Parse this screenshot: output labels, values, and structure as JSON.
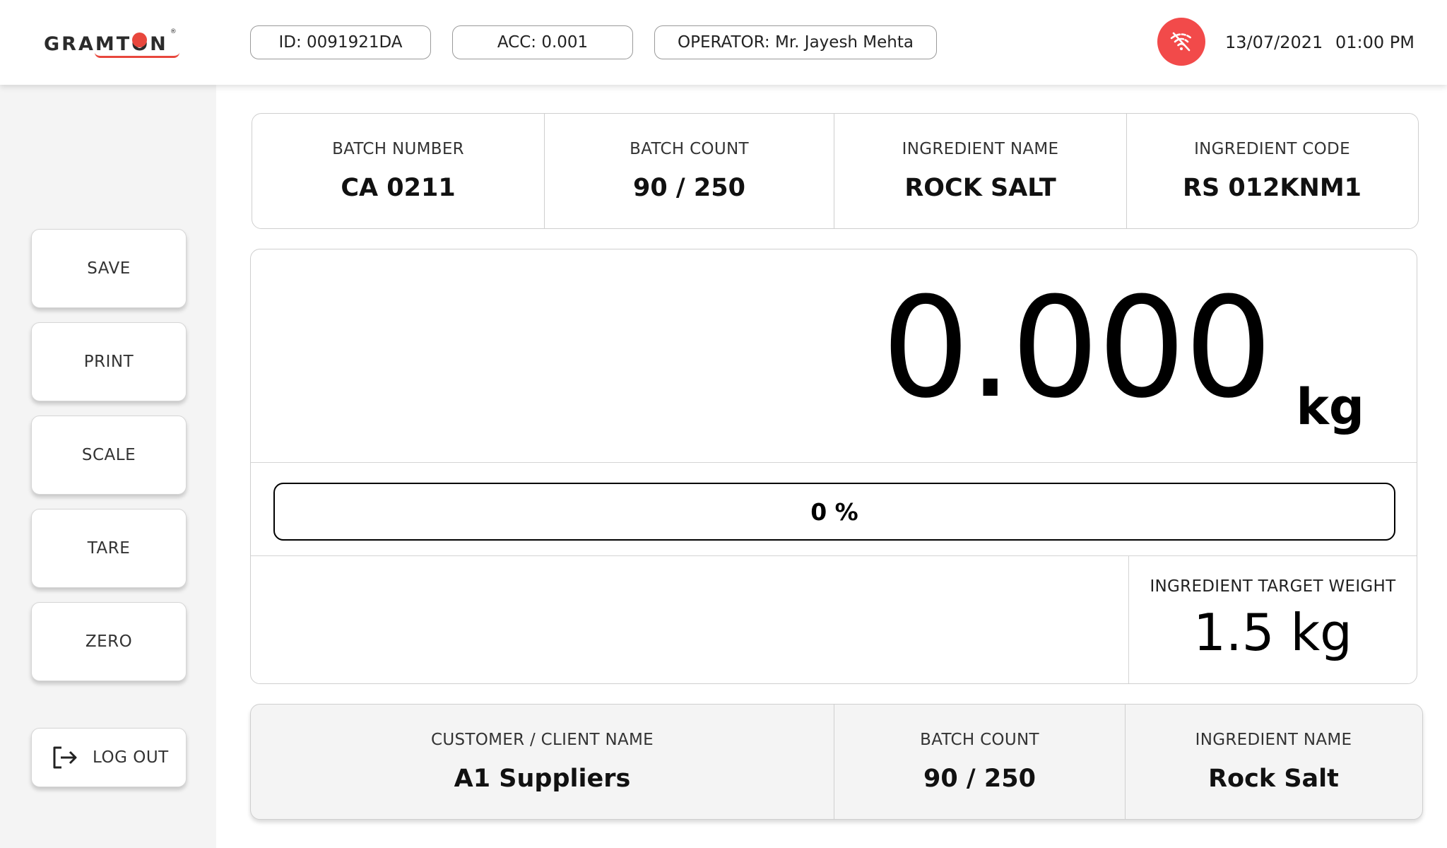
{
  "header": {
    "logo_text": "GRAMTON",
    "logo_reg": "®",
    "id_label": "ID: 0091921DA",
    "acc_label": "ACC: 0.001",
    "operator_label": "OPERATOR: Mr. Jayesh Mehta",
    "date": "13/07/2021",
    "time": "01:00 PM",
    "wifi_status": "disconnected",
    "wifi_color": "#f24a4a"
  },
  "sidebar": {
    "save": "SAVE",
    "print": "PRINT",
    "scale": "SCALE",
    "tare": "TARE",
    "zero": "ZERO",
    "logout": "LOG OUT"
  },
  "batch_info": {
    "batch_number_label": "BATCH NUMBER",
    "batch_number": "CA 0211",
    "batch_count_label": "BATCH COUNT",
    "batch_count": "90 / 250",
    "ingredient_name_label": "INGREDIENT NAME",
    "ingredient_name": "ROCK SALT",
    "ingredient_code_label": "INGREDIENT CODE",
    "ingredient_code": "RS 012KNM1"
  },
  "scale": {
    "weight": "0.000",
    "unit": "kg",
    "progress_text": "0 %",
    "progress_fraction": 0,
    "target_label": "INGREDIENT TARGET WEIGHT",
    "target_value": "1.5 kg"
  },
  "client_info": {
    "customer_label": "CUSTOMER / CLIENT NAME",
    "customer": "A1 Suppliers",
    "batch_count_label": "BATCH COUNT",
    "batch_count": "90 / 250",
    "ingredient_name_label": "INGREDIENT NAME",
    "ingredient_name": "Rock Salt"
  },
  "colors": {
    "accent_red": "#e8473d",
    "sidebar_bg": "#f4f4f4"
  }
}
